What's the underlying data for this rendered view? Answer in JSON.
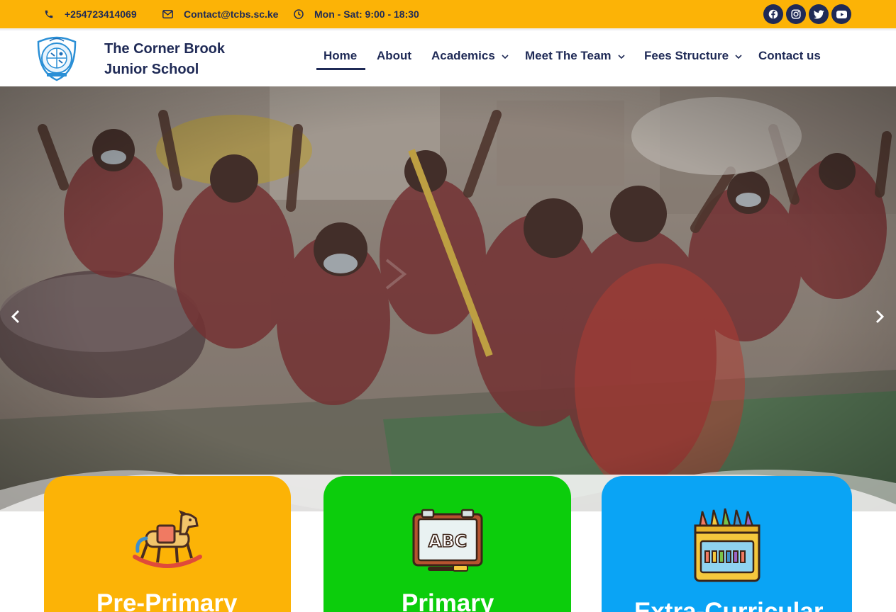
{
  "topbar": {
    "phone": "+254723414069",
    "email": "Contact@tcbs.sc.ke",
    "hours": "Mon - Sat: 9:00 - 18:30",
    "social": [
      "facebook-icon",
      "instagram-icon",
      "twitter-icon",
      "youtube-icon"
    ],
    "background": "#fcb306",
    "text_color": "#1f2a56"
  },
  "header": {
    "brand_line1": "The Corner Brook",
    "brand_line2": "Junior School",
    "nav": {
      "home": "Home",
      "about": "About",
      "academics": "Academics",
      "team": "Meet The Team",
      "fees": "Fees Structure",
      "contact": "Contact us"
    },
    "active_item": "Home"
  },
  "hero": {
    "slider_prev": "chevron-left-icon",
    "slider_next": "chevron-right-icon"
  },
  "cards": [
    {
      "title": "Pre-Primary",
      "icon": "rocking-horse-icon",
      "color": "#fcb306"
    },
    {
      "title": "Primary",
      "icon": "abc-board-icon",
      "color": "#0ccd0c"
    },
    {
      "title": "Extra-Curricular",
      "icon": "crayons-icon",
      "color": "#0aa4f5"
    }
  ]
}
